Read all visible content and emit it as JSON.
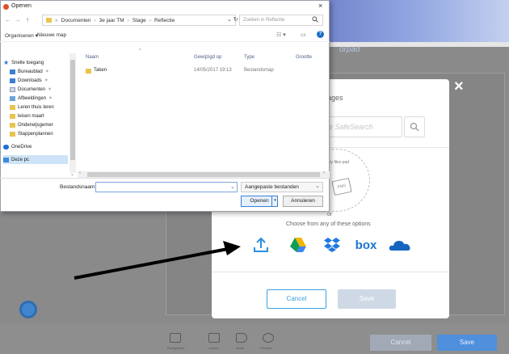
{
  "background_app": {
    "brand": "orpad",
    "toolbar": [
      "Background",
      "Layout",
      "Audio",
      "Preview"
    ],
    "cancel": "Cancel",
    "save": "Save"
  },
  "modal": {
    "close": "×",
    "title_partial": "our images",
    "search_placeholder": "ogle SafeSearch",
    "drop_text": "any files pad",
    "badge": "PNG",
    "or": "or",
    "choose": "Choose from any of these options",
    "services": [
      "upload-icon",
      "google-drive-icon",
      "dropbox-icon",
      "box-icon",
      "onedrive-icon"
    ],
    "box_label": "box",
    "cancel": "Cancel",
    "save": "Save"
  },
  "dialog": {
    "title": "Openen",
    "close": "×",
    "path": [
      "Documenten",
      "3e jaar TM",
      "Stage",
      "Reflectie"
    ],
    "search_placeholder": "Zoeken in Reflectie",
    "toolbar": {
      "organize": "Organiseren ▾",
      "new_folder": "Nieuwe map"
    },
    "nav": [
      {
        "label": "Snelle toegang",
        "icon": "star-icon"
      },
      {
        "label": "Bureaublad",
        "icon": "folder-icon"
      },
      {
        "label": "Downloads",
        "icon": "download-folder-icon"
      },
      {
        "label": "Documenten",
        "icon": "documents-icon"
      },
      {
        "label": "Afbeeldingen",
        "icon": "pictures-icon"
      },
      {
        "label": "Leren thuis leren",
        "icon": "folder-icon"
      },
      {
        "label": "leisen maart",
        "icon": "folder-icon"
      },
      {
        "label": "Onderwijsgemer",
        "icon": "folder-icon"
      },
      {
        "label": "Stappenplannen",
        "icon": "folder-icon"
      },
      {
        "label": "OneDrive",
        "icon": "onedrive-icon"
      },
      {
        "label": "Deze pc",
        "icon": "pc-icon"
      }
    ],
    "columns": [
      "Naam",
      "Gewijzigd op",
      "Type",
      "Grootte"
    ],
    "files": [
      {
        "name": "Taken",
        "modified": "14/05/2017 19:13",
        "type": "Bestandsmap",
        "size": ""
      }
    ],
    "filename_label": "Bestandsnaam:",
    "filename_value": "",
    "filter": "Aangepaste bestanden",
    "open": "Openen",
    "cancel": "Annuleren"
  }
}
